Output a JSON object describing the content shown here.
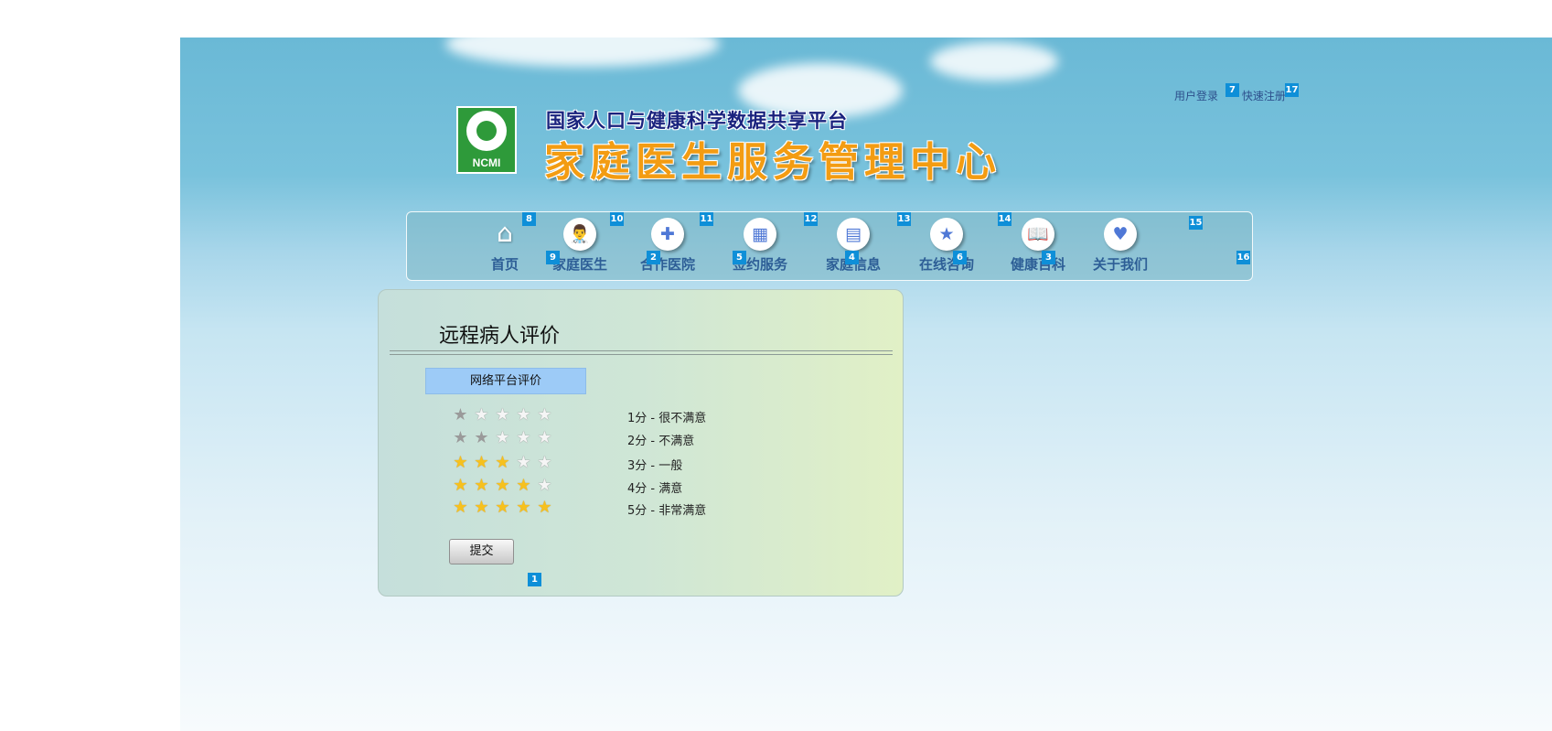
{
  "header": {
    "subtitle": "国家人口与健康科学数据共享平台",
    "title": "家庭医生服务管理中心",
    "logo_text": "NCMI",
    "links": [
      {
        "label": "用户登录",
        "icon": "login-link"
      },
      {
        "label": "快速注册",
        "icon": "register-link"
      }
    ]
  },
  "nav": {
    "items": [
      {
        "label": "首页",
        "icon": "home-icon",
        "glyph": "⌂"
      },
      {
        "label": "家庭医生",
        "icon": "doctor-icon",
        "glyph": "👨‍⚕"
      },
      {
        "label": "合作医院",
        "icon": "hospital-icon",
        "glyph": "✚"
      },
      {
        "label": "签约服务",
        "icon": "calendar-icon",
        "glyph": "▦"
      },
      {
        "label": "家庭信息",
        "icon": "id-card-icon",
        "glyph": "▤"
      },
      {
        "label": "在线咨询",
        "icon": "star-icon",
        "glyph": "★"
      },
      {
        "label": "健康百科",
        "icon": "book-icon",
        "glyph": "📖"
      },
      {
        "label": "关于我们",
        "icon": "handshake-icon",
        "glyph": "♥"
      }
    ]
  },
  "panel": {
    "title": "远程病人评价",
    "tab_label": "网络平台评价",
    "ratings": [
      {
        "score": 1,
        "text": "1分 - 很不满意"
      },
      {
        "score": 2,
        "text": "2分 - 不满意"
      },
      {
        "score": 3,
        "text": "3分 - 一般"
      },
      {
        "score": 4,
        "text": "4分 - 满意"
      },
      {
        "score": 5,
        "text": "5分 - 非常满意"
      }
    ],
    "submit_label": "提交"
  },
  "badges": [
    "1",
    "2",
    "3",
    "4",
    "5",
    "6",
    "7",
    "8",
    "9",
    "10",
    "11",
    "12",
    "13",
    "14",
    "15",
    "16",
    "17"
  ],
  "colors": {
    "accent_blue": "#0e8fd8",
    "title_orange": "#f39c12",
    "tab_blue": "#9dcbf7",
    "star_gold": "#f6c11e"
  }
}
